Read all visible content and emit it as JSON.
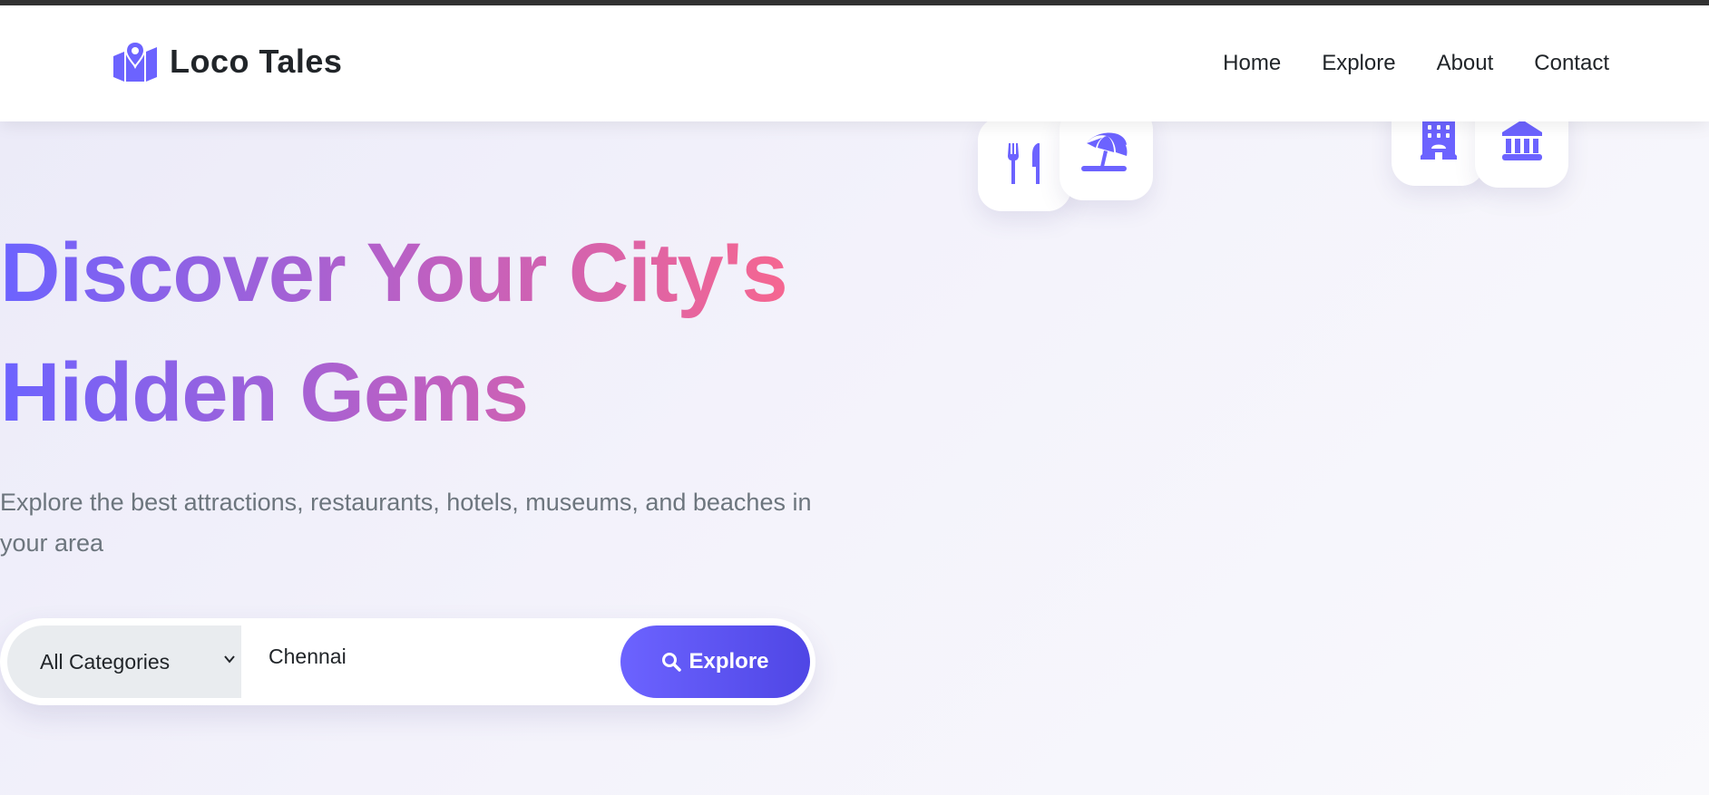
{
  "brand": {
    "name": "Loco Tales",
    "accent": "#6c63ff"
  },
  "nav": [
    {
      "label": "Home"
    },
    {
      "label": "Explore"
    },
    {
      "label": "About"
    },
    {
      "label": "Contact"
    }
  ],
  "floating_icons": [
    "restaurant-icon",
    "beach-umbrella-icon",
    "hotel-icon",
    "museum-icon"
  ],
  "hero": {
    "title_line1": "Discover Your City's",
    "title_line2": "Hidden Gems",
    "subtitle": "Explore the best attractions, restaurants, hotels, museums, and beaches in your area"
  },
  "search": {
    "category": "All Categories",
    "location": "Chennai",
    "button": "Explore"
  }
}
